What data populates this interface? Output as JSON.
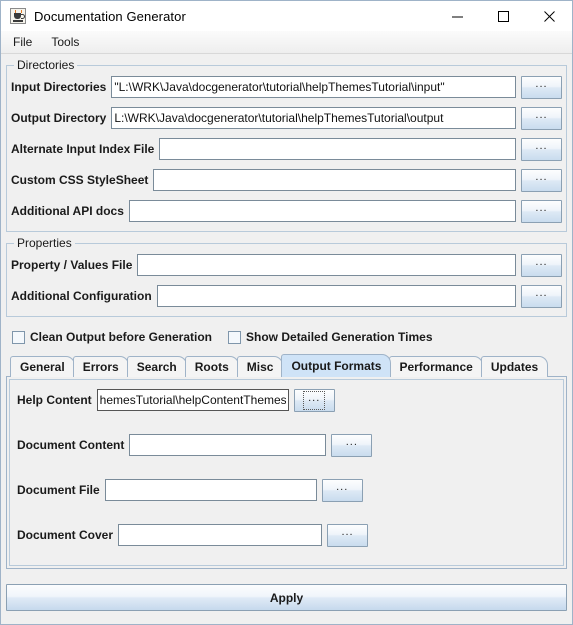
{
  "window": {
    "title": "Documentation Generator",
    "icon": "java-coffee-cup-icon",
    "minimize": "—",
    "maximize": "□",
    "close": "✕"
  },
  "menubar": {
    "items": [
      {
        "label": "File"
      },
      {
        "label": "Tools"
      }
    ]
  },
  "directories": {
    "title": "Directories",
    "browse_label": "...",
    "fields": [
      {
        "label": "Input Directories",
        "value": "\"L:\\WRK\\Java\\docgenerator\\tutorial\\helpThemesTutorial\\input\"",
        "placeholder": ""
      },
      {
        "label": "Output Directory",
        "value": "L:\\WRK\\Java\\docgenerator\\tutorial\\helpThemesTutorial\\output",
        "placeholder": ""
      },
      {
        "label": "Alternate Input Index File",
        "value": "",
        "placeholder": ""
      },
      {
        "label": "Custom CSS StyleSheet",
        "value": "",
        "placeholder": ""
      },
      {
        "label": "Additional API docs",
        "value": "",
        "placeholder": ""
      }
    ]
  },
  "properties": {
    "title": "Properties",
    "browse_label": "...",
    "fields": [
      {
        "label": "Property / Values File",
        "value": "",
        "placeholder": ""
      },
      {
        "label": "Additional Configuration",
        "value": "",
        "placeholder": ""
      }
    ],
    "checkboxes": [
      {
        "label": "Clean Output before Generation",
        "checked": false
      },
      {
        "label": "Show Detailed Generation Times",
        "checked": false
      }
    ]
  },
  "tabs": {
    "items": [
      {
        "label": "General",
        "selected": false
      },
      {
        "label": "Errors",
        "selected": false
      },
      {
        "label": "Search",
        "selected": false
      },
      {
        "label": "Roots",
        "selected": false
      },
      {
        "label": "Misc",
        "selected": false
      },
      {
        "label": "Output Formats",
        "selected": true
      },
      {
        "label": "Performance",
        "selected": false
      },
      {
        "label": "Updates",
        "selected": false
      }
    ],
    "selected_index": 5
  },
  "output_formats": {
    "browse_label": "...",
    "fields": [
      {
        "label": "Help Content",
        "value": "hemesTutorial\\helpContentThemes.xml",
        "placeholder": "",
        "focused": true
      },
      {
        "label": "Document Content",
        "value": "",
        "placeholder": "",
        "focused": false
      },
      {
        "label": "Document File",
        "value": "",
        "placeholder": "",
        "focused": false
      },
      {
        "label": "Document Cover",
        "value": "",
        "placeholder": "",
        "focused": false
      }
    ]
  },
  "footer": {
    "apply_label": "Apply"
  },
  "colors": {
    "background": "#f0f0f0",
    "selected_tab": "#cfe3f7",
    "group_border": "#b8cada",
    "field_border": "#7a8b99"
  }
}
